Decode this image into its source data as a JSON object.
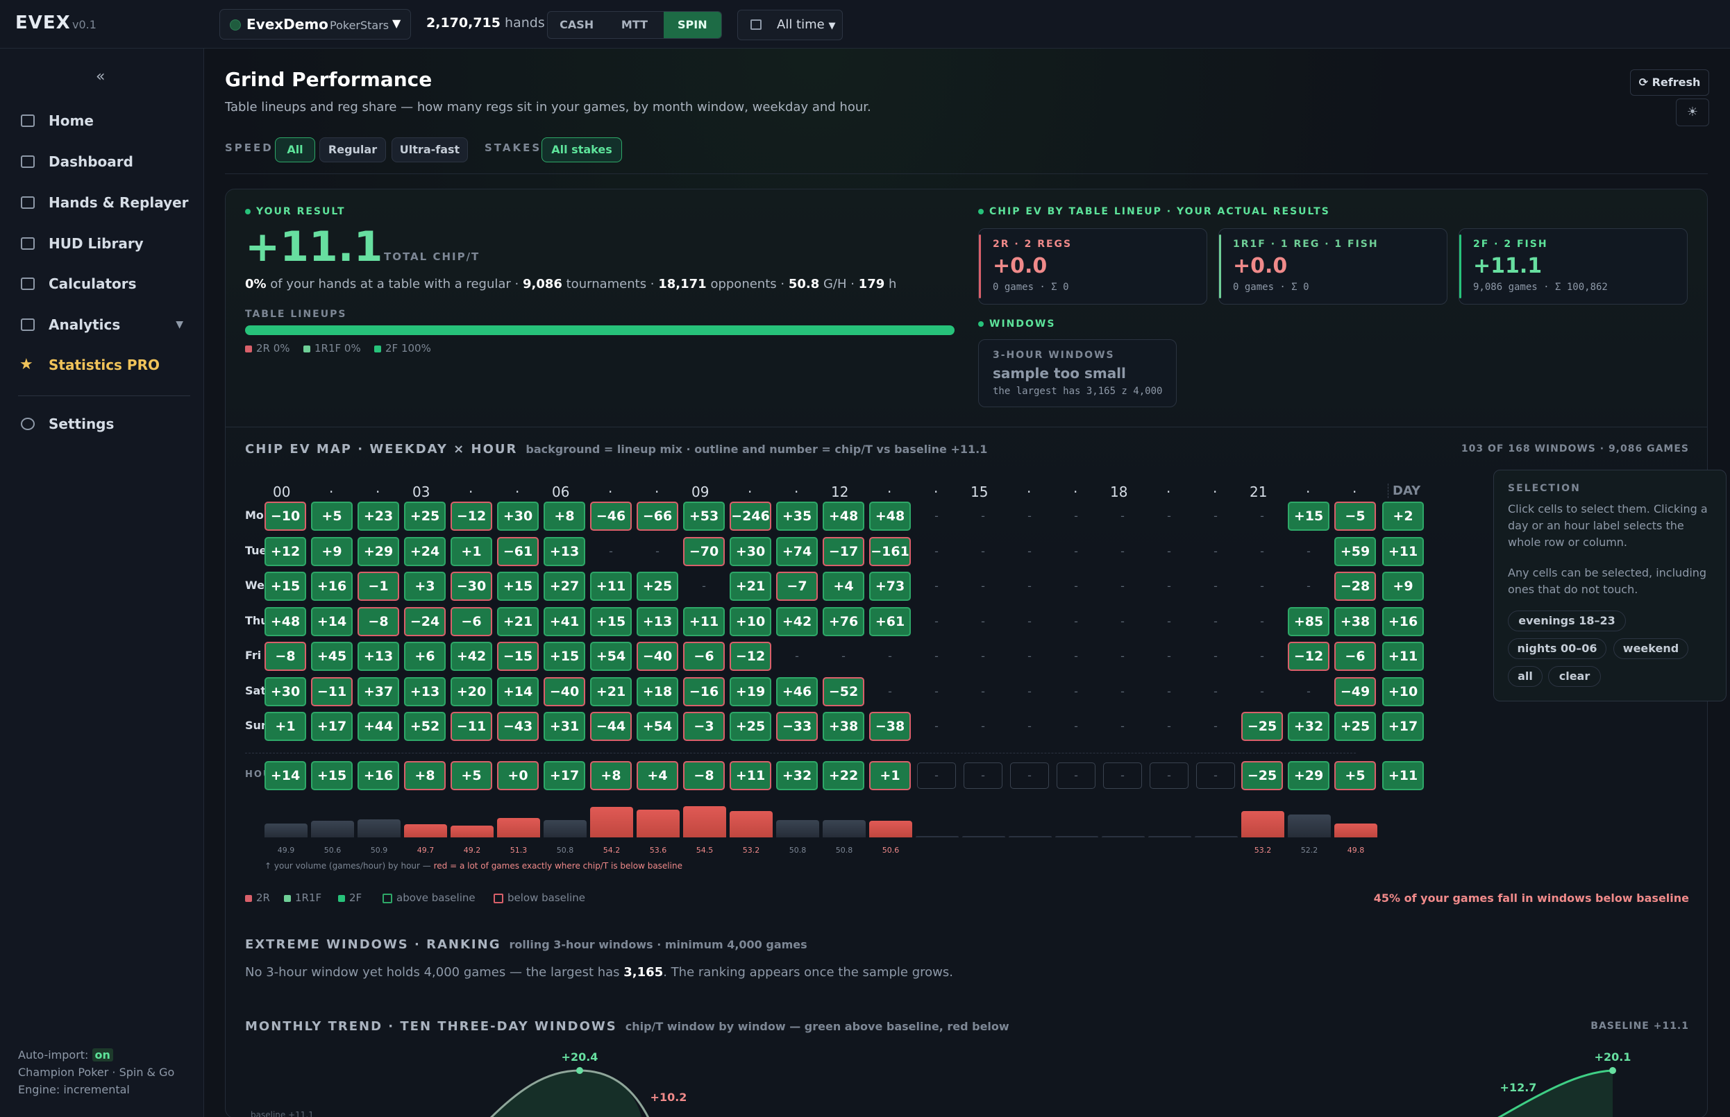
{
  "app": {
    "logo": "EVEX",
    "version": "v0.1",
    "account": "EvexDemo",
    "site": "PokerStars",
    "hands_count": "2,170,715",
    "hands_label": "hands",
    "modes": [
      "CASH",
      "MTT",
      "SPIN"
    ],
    "active_mode": "SPIN",
    "time_filter": "All time"
  },
  "sidebar": {
    "items": [
      "Home",
      "Dashboard",
      "Hands & Replayer",
      "HUD Library",
      "Calculators",
      "Analytics",
      "Statistics PRO"
    ],
    "settings": "Settings",
    "auto_import_label": "Auto-import:",
    "auto_import_value": "on",
    "footer1": "Champion Poker · Spin & Go",
    "footer2": "Engine: incremental"
  },
  "page": {
    "title": "Grind Performance",
    "subtitle": "Table lineups and reg share — how many regs sit in your games, by month window, weekday and hour.",
    "refresh": "⟳ Refresh"
  },
  "filters": {
    "speed_label": "SPEED",
    "speed": [
      "All",
      "Regular",
      "Ultra-fast"
    ],
    "stakes_label": "STAKES",
    "stakes": "All stakes"
  },
  "result": {
    "label": "YOUR RESULT",
    "value": "+11.1",
    "unit": "TOTAL CHIP/T",
    "stats": [
      {
        "v": "0%",
        "t": " of your hands at a table with a regular · "
      },
      {
        "v": "9,086",
        "t": " tournaments · "
      },
      {
        "v": "18,171",
        "t": " opponents · "
      },
      {
        "v": "50.8",
        "t": " G/H · "
      },
      {
        "v": "179",
        "t": " h"
      }
    ],
    "lineups_label": "TABLE LINEUPS",
    "legend": [
      "2R 0%",
      "1R1F 0%",
      "2F 100%"
    ],
    "share_2f": 1.0
  },
  "lineup_ev": {
    "label": "CHIP EV BY TABLE LINEUP · YOUR ACTUAL RESULTS",
    "cards": [
      {
        "title": "2R · 2 REGS",
        "value": "+0.0",
        "sub": "0 games · Σ 0"
      },
      {
        "title": "1R1F · 1 REG · 1 FISH",
        "value": "+0.0",
        "sub": "0 games · Σ 0"
      },
      {
        "title": "2F · 2 FISH",
        "value": "+11.1",
        "sub": "9,086 games · Σ 100,862"
      }
    ]
  },
  "windows": {
    "label": "WINDOWS",
    "title": "3-HOUR WINDOWS",
    "value": "sample too small",
    "sub": "the largest has 3,165 z 4,000"
  },
  "map": {
    "title": "CHIP EV MAP · WEEKDAY × HOUR",
    "note": "background = lineup mix · outline and number = chip/T vs baseline +11.1",
    "right": "103 OF 168 WINDOWS · 9,086 GAMES",
    "hour_labels": [
      "00",
      "·",
      "·",
      "03",
      "·",
      "·",
      "06",
      "·",
      "·",
      "09",
      "·",
      "·",
      "12",
      "·",
      "·",
      "15",
      "·",
      "·",
      "18",
      "·",
      "·",
      "21",
      "·",
      "·"
    ],
    "day_header": "DAY",
    "days": [
      "Mon",
      "Tue",
      "Wed",
      "Thu",
      "Fri",
      "Sat",
      "Sun"
    ],
    "rows": [
      [
        "−10",
        "+5",
        "+23",
        "+25",
        "−12",
        "+30",
        "+8",
        "−46",
        "−66",
        "+53",
        "−246",
        "+35",
        "+48",
        "+48",
        "-",
        "-",
        "-",
        "-",
        "-",
        "-",
        "-",
        "-",
        "+15",
        "−5",
        "+2"
      ],
      [
        "+12",
        "+9",
        "+29",
        "+24",
        "+1",
        "−61",
        "+13",
        "-",
        "-",
        "−70",
        "+30",
        "+74",
        "−17",
        "−161",
        "-",
        "-",
        "-",
        "-",
        "-",
        "-",
        "-",
        "-",
        "-",
        "+59",
        "+11"
      ],
      [
        "+15",
        "+16",
        "−1",
        "+3",
        "−30",
        "+15",
        "+27",
        "+11",
        "+25",
        "-",
        "+21",
        "−7",
        "+4",
        "+73",
        "-",
        "-",
        "-",
        "-",
        "-",
        "-",
        "-",
        "-",
        "-",
        "−28",
        "+9"
      ],
      [
        "+48",
        "+14",
        "−8",
        "−24",
        "−6",
        "+21",
        "+41",
        "+15",
        "+13",
        "+11",
        "+10",
        "+42",
        "+76",
        "+61",
        "-",
        "-",
        "-",
        "-",
        "-",
        "-",
        "-",
        "-",
        "+85",
        "+38",
        "+16"
      ],
      [
        "−8",
        "+45",
        "+13",
        "+6",
        "+42",
        "−15",
        "+15",
        "+54",
        "−40",
        "−6",
        "−12",
        "-",
        "-",
        "-",
        "-",
        "-",
        "-",
        "-",
        "-",
        "-",
        "-",
        "-",
        "−12",
        "−6",
        "+11"
      ],
      [
        "+30",
        "−11",
        "+37",
        "+13",
        "+20",
        "+14",
        "−40",
        "+21",
        "+18",
        "−16",
        "+19",
        "+46",
        "−52",
        "-",
        "-",
        "-",
        "-",
        "-",
        "-",
        "-",
        "-",
        "-",
        "-",
        "−49",
        "+10"
      ],
      [
        "+1",
        "+17",
        "+44",
        "+52",
        "−11",
        "−43",
        "+31",
        "−44",
        "+54",
        "−3",
        "+25",
        "−33",
        "+38",
        "−38",
        "-",
        "-",
        "-",
        "-",
        "-",
        "-",
        "-",
        "−25",
        "+32",
        "+25",
        "+17"
      ]
    ],
    "hour_label": "HOUR",
    "hour_row": [
      "+14",
      "+15",
      "+16",
      "+8",
      "+5",
      "+0",
      "+17",
      "+8",
      "+4",
      "−8",
      "+11",
      "+32",
      "+22",
      "+1",
      "-",
      "-",
      "-",
      "-",
      "-",
      "-",
      "-",
      "−25",
      "+29",
      "+5",
      "+11"
    ],
    "volume": [
      49.9,
      50.6,
      50.9,
      49.7,
      49.2,
      51.3,
      50.8,
      54.2,
      53.6,
      54.5,
      53.2,
      50.8,
      50.8,
      50.6,
      null,
      null,
      null,
      null,
      null,
      null,
      null,
      53.2,
      52.2,
      49.8
    ],
    "volume_labels": [
      "49.9",
      "50.6",
      "50.9",
      "49.7",
      "49.2",
      "51.3",
      "50.8",
      "54.2",
      "53.6",
      "54.5",
      "53.2",
      "50.8",
      "50.8",
      "50.6",
      "",
      "",
      "",
      "",
      "",
      "",
      "",
      "53.2",
      "52.2",
      "49.8"
    ],
    "volume_note": "↑ your volume (games/hour) by hour — ",
    "volume_note_red": "red = a lot of games exactly where chip/T is below baseline",
    "legend": [
      "2R",
      "1R1F",
      "2F",
      "above baseline",
      "below baseline"
    ],
    "warning": "45% of your games fall in windows below baseline"
  },
  "selection": {
    "title": "SELECTION",
    "p1": "Click cells to select them. Clicking a day or an hour label selects the whole row or column.",
    "p2": "Any cells can be selected, including ones that do not touch.",
    "chips": [
      "evenings 18–23",
      "nights 00–06",
      "weekend",
      "all",
      "clear"
    ]
  },
  "extreme": {
    "title": "EXTREME WINDOWS · RANKING",
    "sub": "rolling 3-hour windows · minimum 4,000 games",
    "text1": "No 3-hour window yet holds 4,000 games — the largest has ",
    "text_num": "3,165",
    "text2": ". The ranking appears once the sample grows."
  },
  "trend": {
    "title": "MONTHLY TREND · TEN THREE-DAY WINDOWS",
    "sub": "chip/T window by window — green above baseline, red below",
    "right": "BASELINE +11.1",
    "labels": [
      "+20.4",
      "+10.2",
      "+12.7",
      "+20.1"
    ],
    "baseline_label": "baseline +11.1"
  },
  "colors": {
    "accent": "#27c27a",
    "negative": "#d9606a",
    "pro": "#f0c35a"
  }
}
